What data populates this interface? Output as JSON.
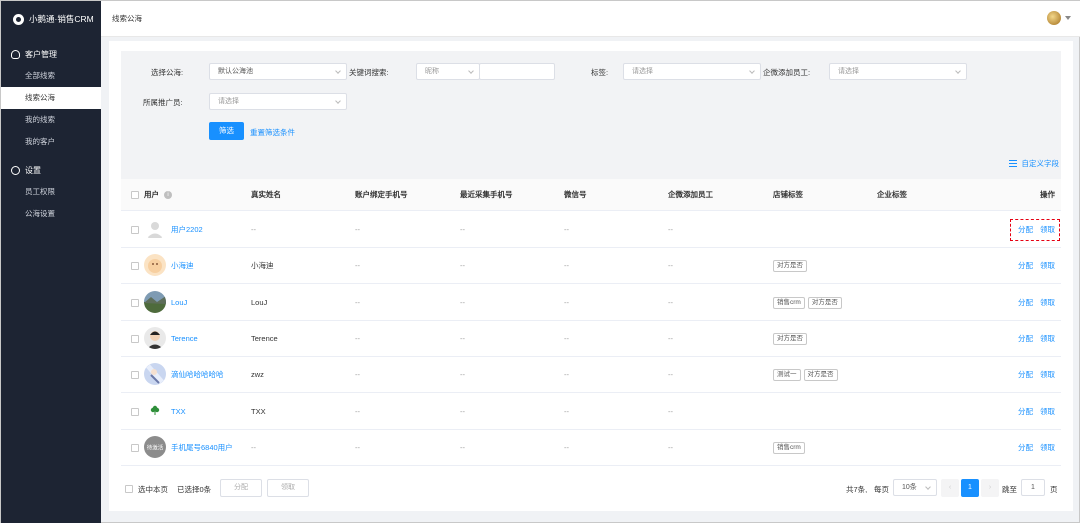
{
  "app": {
    "title": "小鹅通·销售CRM"
  },
  "sidebar": {
    "groups": [
      {
        "label": "客户管理",
        "icon": "user-icon",
        "items": [
          "全部线索",
          "线索公海",
          "我的线索",
          "我的客户"
        ]
      },
      {
        "label": "设置",
        "icon": "gear-icon",
        "items": [
          "员工权限",
          "公海设置"
        ]
      }
    ],
    "active_item": "线索公海"
  },
  "header": {
    "breadcrumb": "线索公海"
  },
  "filters": {
    "pool_label": "选择公海:",
    "pool_value": "默认公海池",
    "keyword_label": "关键词搜索:",
    "keyword_type": "昵称",
    "keyword_value": "",
    "tag_label": "标签:",
    "tag_placeholder": "请选择",
    "staff_label": "企微添加员工:",
    "staff_placeholder": "请选择",
    "promoter_label": "所属推广员:",
    "promoter_placeholder": "请选择",
    "filter_button": "筛选",
    "reset_link": "重置筛选条件"
  },
  "custom_fields_link": "自定义字段",
  "table": {
    "columns": [
      "用户",
      "真实姓名",
      "账户绑定手机号",
      "最近采集手机号",
      "微信号",
      "企微添加员工",
      "店铺标签",
      "企业标签",
      "操作"
    ],
    "rows": [
      {
        "user": "用户2202",
        "real_name": "--",
        "bound_phone": "--",
        "recent_phone": "--",
        "wechat": "--",
        "staff": "--",
        "shop_tags": [],
        "corp_tags": "",
        "avatar": "placeholder"
      },
      {
        "user": "小海迪",
        "real_name": "小海迪",
        "bound_phone": "--",
        "recent_phone": "--",
        "wechat": "--",
        "staff": "--",
        "shop_tags": [
          "对方是否"
        ],
        "corp_tags": "",
        "avatar": "peach"
      },
      {
        "user": "LouJ",
        "real_name": "LouJ",
        "bound_phone": "--",
        "recent_phone": "--",
        "wechat": "--",
        "staff": "--",
        "shop_tags": [
          "销售crm",
          "对方是否"
        ],
        "corp_tags": "",
        "avatar": "landscape"
      },
      {
        "user": "Terence",
        "real_name": "Terence",
        "bound_phone": "--",
        "recent_phone": "--",
        "wechat": "--",
        "staff": "--",
        "shop_tags": [
          "对方是否"
        ],
        "corp_tags": "",
        "avatar": "person"
      },
      {
        "user": "滴仙哈哈哈哈哈",
        "real_name": "zwz",
        "bound_phone": "--",
        "recent_phone": "--",
        "wechat": "--",
        "staff": "--",
        "shop_tags": [
          "测试一",
          "对方是否"
        ],
        "corp_tags": "",
        "avatar": "anime"
      },
      {
        "user": "TXX",
        "real_name": "TXX",
        "bound_phone": "--",
        "recent_phone": "--",
        "wechat": "--",
        "staff": "--",
        "shop_tags": [],
        "corp_tags": "",
        "avatar": "clover"
      },
      {
        "user": "手机尾号6840用户",
        "real_name": "--",
        "bound_phone": "--",
        "recent_phone": "--",
        "wechat": "--",
        "staff": "--",
        "shop_tags": [
          "销售crm"
        ],
        "corp_tags": "",
        "avatar": "badge"
      }
    ],
    "row_actions": [
      "分配",
      "领取"
    ],
    "badge_avatar_text": "待激活"
  },
  "footer": {
    "select_page_label": "选中本页",
    "selected_count": "已选择0条",
    "assign_button": "分配",
    "claim_button": "领取",
    "total": "共7条,",
    "per_page_label": "每页",
    "page_size": "10条",
    "current_page": "1",
    "goto_label": "跳至",
    "goto_value": "1",
    "page_suffix": "页"
  },
  "colors": {
    "sidebar_bg": "#1d2433",
    "primary": "#1890ff",
    "highlight": "#e60012"
  }
}
